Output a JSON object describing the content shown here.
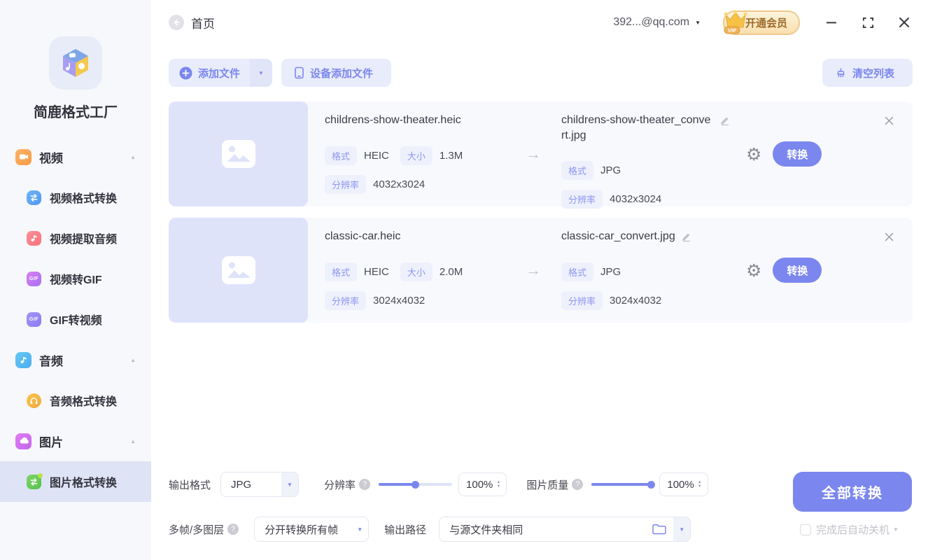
{
  "app": {
    "name": "简鹿格式工厂"
  },
  "titlebar": {
    "home": "首页",
    "account": "392...@qq.com",
    "vip_tag": "VIP",
    "vip_label": "开通会员"
  },
  "toolbar": {
    "add_file": "添加文件",
    "add_from_device": "设备添加文件",
    "clear_list": "清空列表"
  },
  "sidebar": {
    "sections": [
      {
        "label": "视频",
        "items": [
          "视频格式转换",
          "视频提取音频",
          "视频转GIF",
          "GIF转视频"
        ]
      },
      {
        "label": "音频",
        "items": [
          "音频格式转换"
        ]
      },
      {
        "label": "图片",
        "items": [
          "图片格式转换"
        ]
      }
    ],
    "active_item": "图片格式转换"
  },
  "icons": {
    "gif_text": "GIF"
  },
  "labels": {
    "format": "格式",
    "size": "大小",
    "resolution": "分辨率",
    "convert": "转换",
    "arrow": "→"
  },
  "files": [
    {
      "source_name": "childrens-show-theater.heic",
      "source_format": "HEIC",
      "source_size": "1.3M",
      "source_resolution": "4032x3024",
      "output_name": "childrens-show-theater_convert.jpg",
      "output_format": "JPG",
      "output_resolution": "4032x3024"
    },
    {
      "source_name": "classic-car.heic",
      "source_format": "HEIC",
      "source_size": "2.0M",
      "source_resolution": "3024x4032",
      "output_name": "classic-car_convert.jpg",
      "output_format": "JPG",
      "output_resolution": "3024x4032"
    }
  ],
  "settings": {
    "output_format_label": "输出格式",
    "output_format_value": "JPG",
    "resolution_label": "分辨率",
    "resolution_value": "100%",
    "resolution_slider_percent": 50,
    "quality_label": "图片质量",
    "quality_value": "100%",
    "quality_slider_percent": 100,
    "multiframe_label": "多帧/多图层",
    "multiframe_value": "分开转换所有帧",
    "output_path_label": "输出路径",
    "output_path_value": "与源文件夹相同",
    "convert_all": "全部转换",
    "auto_shutdown": "完成后自动关机"
  },
  "colors": {
    "accent": "#7b87ee",
    "accent-light": "#e9ecfb",
    "tag-bg": "#eef0fc",
    "tag-text": "#8d96f0",
    "row-bg": "#f8f9fd",
    "thumb-bg": "#dfe3fa",
    "sidebar-bg": "#f7f8fb",
    "active-bg": "#dfe3f6"
  }
}
